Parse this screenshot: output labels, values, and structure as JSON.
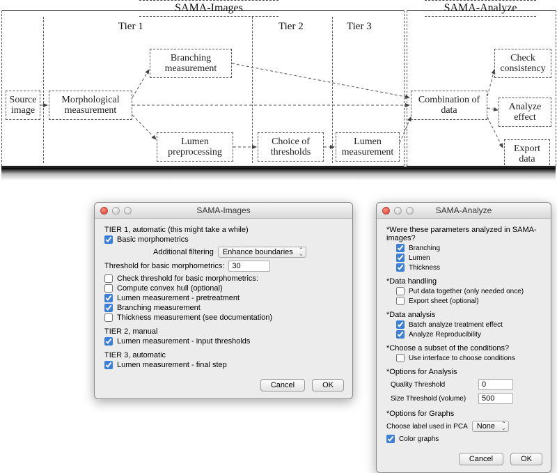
{
  "flow": {
    "headers": {
      "images": "SAMA-Images",
      "analyze": "SAMA-Analyze"
    },
    "tiers": {
      "t1": "Tier 1",
      "t2": "Tier 2",
      "t3": "Tier 3"
    },
    "boxes": {
      "source": "Source\nimage",
      "morph": "Morphological\nmeasurement",
      "branch": "Branching\nmeasurement",
      "lumenPre": "Lumen\npreprocessing",
      "choice": "Choice of\nthresholds",
      "lumenMeas": "Lumen\nmeasurement",
      "comb": "Combination\nof data",
      "check": "Check\nconsistency",
      "analyzeEffect": "Analyze\neffect",
      "export": "Export\ndata"
    }
  },
  "dialogImages": {
    "title": "SAMA-Images",
    "tier1Header": "TIER 1, automatic (this might take a while)",
    "basicMorph": {
      "checked": true,
      "label": "Basic morphometrics"
    },
    "addFilterLabel": "Additional filtering",
    "addFilterValue": "Enhance boundaries",
    "thresholdLabel": "Threshold for basic morphometrics:",
    "thresholdValue": "30",
    "checks": [
      {
        "checked": false,
        "label": "Check threshold for basic morphometrics:"
      },
      {
        "checked": false,
        "label": "Compute convex hull (optional)"
      },
      {
        "checked": true,
        "label": "Lumen measurement - pretreatment"
      },
      {
        "checked": true,
        "label": "Branching measurement"
      },
      {
        "checked": false,
        "label": "Thickness measurement (see documentation)"
      }
    ],
    "tier2Header": "TIER 2, manual",
    "tier2Check": {
      "checked": true,
      "label": "Lumen measurement - input thresholds"
    },
    "tier3Header": "TIER 3, automatic",
    "tier3Check": {
      "checked": true,
      "label": "Lumen measurement - final step"
    },
    "cancel": "Cancel",
    "ok": "OK"
  },
  "dialogAnalyze": {
    "title": "SAMA-Analyze",
    "q1": "*Were these parameters analyzed in SAMA-images?",
    "q1Checks": [
      {
        "checked": true,
        "label": "Branching"
      },
      {
        "checked": true,
        "label": "Lumen"
      },
      {
        "checked": true,
        "label": "Thickness"
      }
    ],
    "q2": "*Data handling",
    "q2Checks": [
      {
        "checked": false,
        "label": "Put data together (only needed once)"
      },
      {
        "checked": false,
        "label": "Export sheet (optional)"
      }
    ],
    "q3": "*Data analysis",
    "q3Checks": [
      {
        "checked": true,
        "label": "Batch analyze treatment effect"
      },
      {
        "checked": true,
        "label": "Analyze Reproducibility"
      }
    ],
    "q4": "*Choose a subset of the conditions?",
    "q4Checks": [
      {
        "checked": false,
        "label": "Use interface to choose conditions"
      }
    ],
    "q5": "*Options for Analysis",
    "qualLabel": "Quality Threshold",
    "qualValue": "0",
    "sizeLabel": "Size Threshold (volume)",
    "sizeValue": "500",
    "q6": "*Options for Graphs",
    "pcaLabel": "Choose label used in PCA",
    "pcaValue": "None",
    "colorGraphs": {
      "checked": true,
      "label": "Color graphs"
    },
    "cancel": "Cancel",
    "ok": "OK"
  }
}
